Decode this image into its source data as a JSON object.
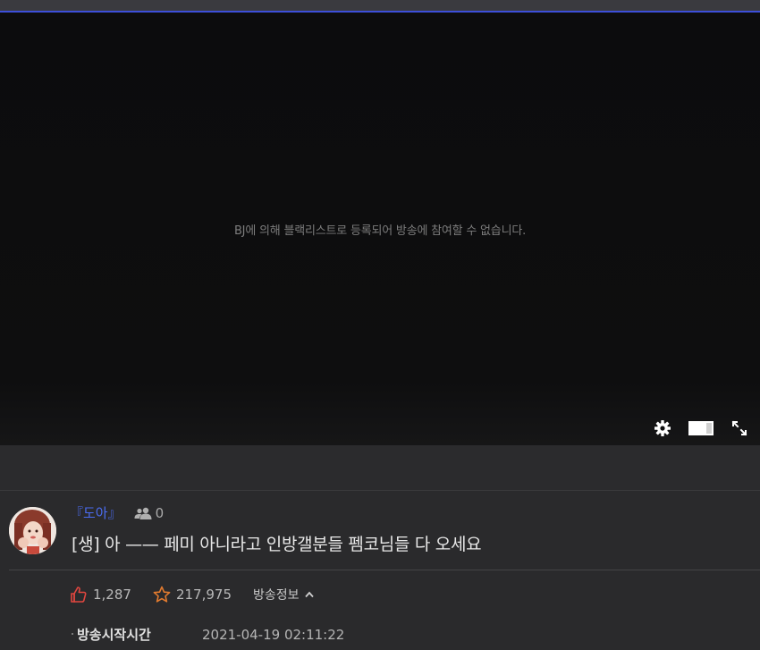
{
  "player": {
    "message": "BJ에 의해 블랙리스트로 등록되어 방송에 참여할 수 없습니다."
  },
  "controls": {
    "settings_icon": "gear-icon",
    "theater_icon": "theater-mode-icon",
    "fullscreen_icon": "fullscreen-icon"
  },
  "broadcast": {
    "bj_name": "『도아』",
    "viewer_count": "0",
    "title": "[생] 아 —— 페미 아니라고 인방갤분들 펨코님들 다 오세요",
    "likes": "1,287",
    "favorites": "217,975",
    "info_toggle_label": "방송정보",
    "start_time_label": "방송시작시간",
    "start_time_value": "2021-04-19 02:11:22"
  },
  "colors": {
    "accent": "#4b6cf0",
    "like": "#e0463f",
    "favorite": "#e07a2f"
  }
}
